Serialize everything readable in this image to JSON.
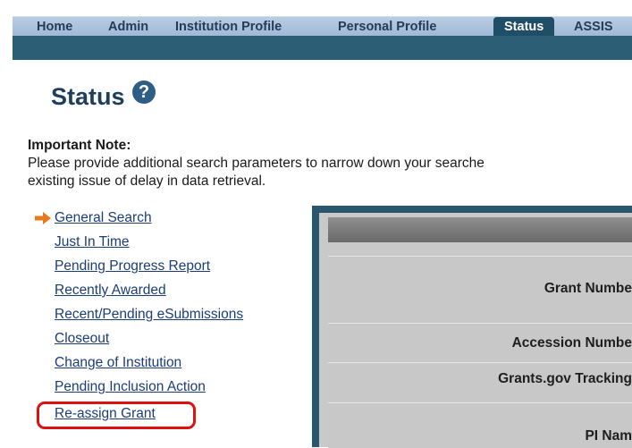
{
  "nav": {
    "tabs": [
      "Home",
      "Admin",
      "Institution Profile",
      "Personal Profile",
      "Status",
      "ASSIS"
    ],
    "active": "Status"
  },
  "page": {
    "title": "Status",
    "help_icon": "question-circle-icon"
  },
  "note": {
    "title": "Important Note:",
    "line1": "Please provide additional search parameters to narrow down your searche",
    "line2": "existing issue of delay in data retrieval."
  },
  "links": [
    "General Search",
    "Just In Time",
    "Pending Progress Report",
    "Recently Awarded",
    "Recent/Pending eSubmissions",
    "Closeout",
    "Change of Institution",
    "Pending Inclusion Action",
    "Re-assign Grant"
  ],
  "current_link_icon": "arrow-right-icon",
  "table": {
    "rows": [
      "Grant Numbe",
      "Accession Numbe",
      "Grants.gov Tracking",
      "PI Nam"
    ]
  },
  "colors": {
    "highlight": "#e01010",
    "arrow": "#e8781e",
    "active_tab": "#1f4e66"
  }
}
